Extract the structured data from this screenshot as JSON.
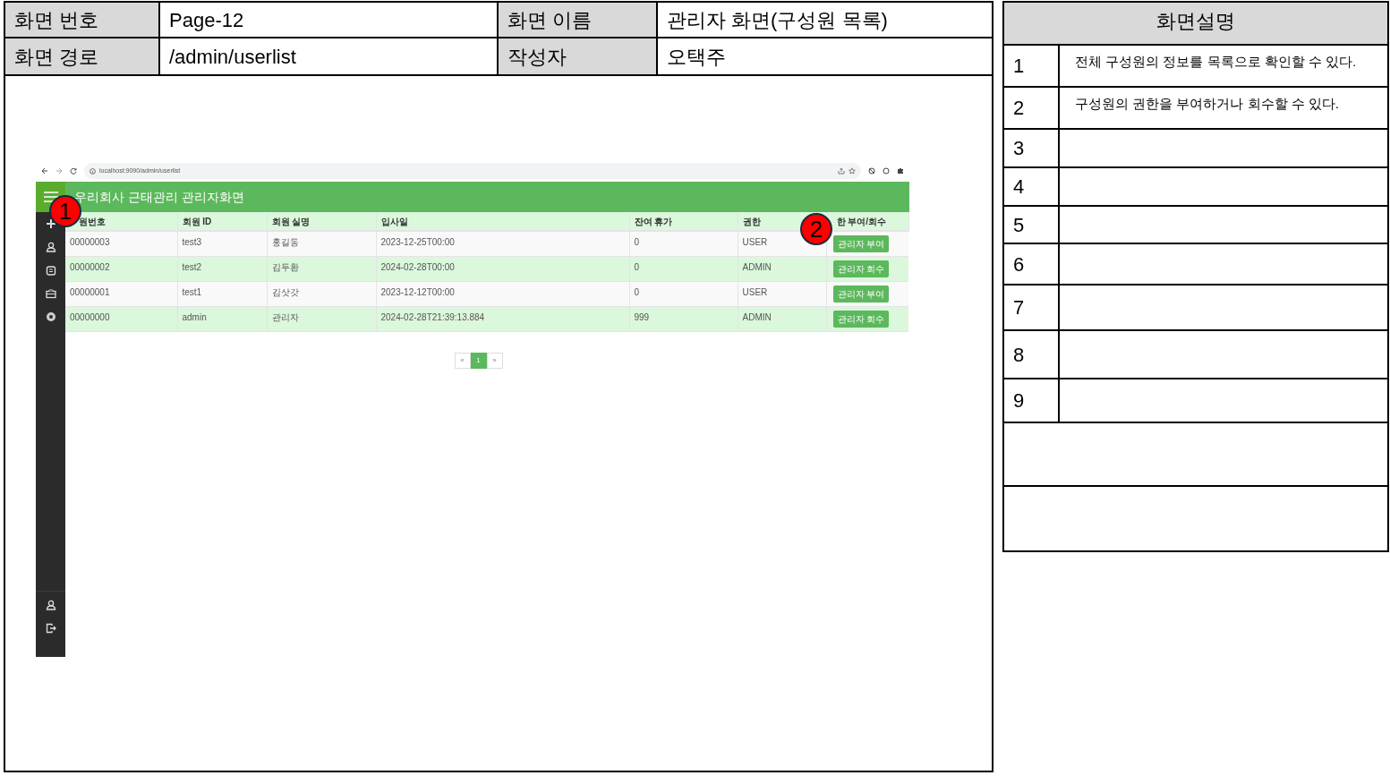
{
  "doc_fields": [
    {
      "label": "화면 번호",
      "value": "Page-12"
    },
    {
      "label": "화면 이름",
      "value": "관리자 화면(구성원 목록)"
    },
    {
      "label": "화면 경로",
      "value": "/admin/userlist"
    },
    {
      "label": "작성자",
      "value": "오택주"
    }
  ],
  "screenshot": {
    "url": "localhost:9090/admin/userlist",
    "app_title": "우리회사 근태관리 관리자화면",
    "table": {
      "columns": [
        "원번호",
        "회원 ID",
        "회원 실명",
        "입사일",
        "잔여 휴가",
        "권한",
        "한 부여/회수"
      ],
      "rows": [
        {
          "cells": [
            "00000003",
            "test3",
            "홍길동",
            "2023-12-25T00:00",
            "0",
            "USER"
          ],
          "action": "관리자 부여"
        },
        {
          "cells": [
            "00000002",
            "test2",
            "김두환",
            "2024-02-28T00:00",
            "0",
            "ADMIN"
          ],
          "action": "관리자 회수"
        },
        {
          "cells": [
            "00000001",
            "test1",
            "김삿갓",
            "2023-12-12T00:00",
            "0",
            "USER"
          ],
          "action": "관리자 부여"
        },
        {
          "cells": [
            "00000000",
            "admin",
            "관리자",
            "2024-02-28T21:39:13.884",
            "999",
            "ADMIN"
          ],
          "action": "관리자 회수"
        }
      ]
    },
    "pagination": [
      {
        "label": "«",
        "selected": false
      },
      {
        "label": "1",
        "selected": true
      },
      {
        "label": "»",
        "selected": false
      }
    ]
  },
  "markers": [
    "1",
    "2"
  ],
  "description": {
    "title": "화면설명",
    "rows": [
      {
        "number": "1",
        "text": "전체 구성원의 정보를 목록으로 확인할 수 있다."
      },
      {
        "number": "2",
        "text": "구성원의 권한을 부여하거나 회수할 수 있다."
      },
      {
        "number": "3"
      },
      {
        "number": "4"
      },
      {
        "number": "5"
      },
      {
        "number": "6"
      },
      {
        "number": "7"
      },
      {
        "number": "8"
      },
      {
        "number": "9"
      }
    ]
  }
}
